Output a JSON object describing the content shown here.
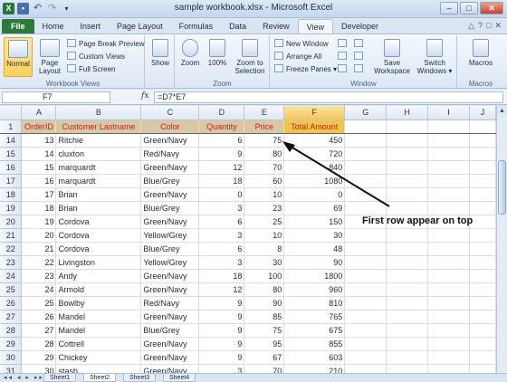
{
  "window": {
    "title": "sample workbook.xlsx - Microsoft Excel",
    "controls": {
      "minimize": "–",
      "restore": "□",
      "close": "✕"
    }
  },
  "qat": {
    "excel": "X",
    "save": "▪",
    "undo": "↶",
    "redo": "↷",
    "more": "▾"
  },
  "ribbon_tabs": [
    "File",
    "Home",
    "Insert",
    "Page Layout",
    "Formulas",
    "Data",
    "Review",
    "View",
    "Developer"
  ],
  "active_tab": "View",
  "ribbon_right": {
    "minimize": "△",
    "help": "?",
    "restore": "□",
    "close": "✕"
  },
  "groups": {
    "workbook_views": {
      "label": "Workbook Views",
      "normal": "Normal",
      "page_layout": "Page Layout",
      "page_break_preview": "Page Break Preview",
      "custom_views": "Custom Views",
      "full_screen": "Full Screen"
    },
    "show": {
      "label": "Show"
    },
    "zoom": {
      "label": "Zoom",
      "zoom": "Zoom",
      "zoom100": "100%",
      "zoom_to_selection": "Zoom to Selection"
    },
    "window": {
      "label": "Window",
      "new_window": "New Window",
      "arrange_all": "Arrange All",
      "freeze_panes": "Freeze Panes ▾",
      "save_workspace": "Save Workspace",
      "switch_windows": "Switch Windows ▾"
    },
    "macros": {
      "label": "Macros",
      "macros": "Macros"
    }
  },
  "formula_bar": {
    "name_box": "F7",
    "fx": "fx",
    "formula": "=D7*E7"
  },
  "columns": [
    "A",
    "B",
    "C",
    "D",
    "E",
    "F",
    "G",
    "H",
    "I",
    "J"
  ],
  "selected_column": "F",
  "header_row": {
    "row": "1",
    "cells": [
      "OrderID",
      "Customer Lastname",
      "Color",
      "Quantity",
      "Price",
      "Total Amount"
    ]
  },
  "rows": [
    {
      "row": "14",
      "id": "13",
      "name": "Ritchie",
      "color": "Green/Navy",
      "qty": "6",
      "price": "75",
      "total": "450"
    },
    {
      "row": "15",
      "id": "14",
      "name": "cluxton",
      "color": "Red/Navy",
      "qty": "9",
      "price": "80",
      "total": "720"
    },
    {
      "row": "16",
      "id": "15",
      "name": "marquardt",
      "color": "Green/Navy",
      "qty": "12",
      "price": "70",
      "total": "840"
    },
    {
      "row": "17",
      "id": "16",
      "name": "marquardt",
      "color": "Blue/Grey",
      "qty": "18",
      "price": "60",
      "total": "1080"
    },
    {
      "row": "18",
      "id": "17",
      "name": "Brian",
      "color": "Green/Navy",
      "qty": "0",
      "price": "10",
      "total": "0"
    },
    {
      "row": "19",
      "id": "18",
      "name": "Brian",
      "color": "Blue/Grey",
      "qty": "3",
      "price": "23",
      "total": "69"
    },
    {
      "row": "20",
      "id": "19",
      "name": "Cordova",
      "color": "Green/Navy",
      "qty": "6",
      "price": "25",
      "total": "150"
    },
    {
      "row": "21",
      "id": "20",
      "name": "Cordova",
      "color": "Yellow/Grey",
      "qty": "3",
      "price": "10",
      "total": "30"
    },
    {
      "row": "22",
      "id": "21",
      "name": "Cordova",
      "color": "Blue/Grey",
      "qty": "6",
      "price": "8",
      "total": "48"
    },
    {
      "row": "23",
      "id": "22",
      "name": "Livingston",
      "color": "Yellow/Grey",
      "qty": "3",
      "price": "30",
      "total": "90"
    },
    {
      "row": "24",
      "id": "23",
      "name": "Andy",
      "color": "Green/Navy",
      "qty": "18",
      "price": "100",
      "total": "1800"
    },
    {
      "row": "25",
      "id": "24",
      "name": "Armold",
      "color": "Green/Navy",
      "qty": "12",
      "price": "80",
      "total": "960"
    },
    {
      "row": "26",
      "id": "25",
      "name": "Bowlby",
      "color": "Red/Navy",
      "qty": "9",
      "price": "90",
      "total": "810"
    },
    {
      "row": "27",
      "id": "26",
      "name": "Mandel",
      "color": "Green/Navy",
      "qty": "9",
      "price": "85",
      "total": "765"
    },
    {
      "row": "28",
      "id": "27",
      "name": "Mandel",
      "color": "Blue/Grey",
      "qty": "9",
      "price": "75",
      "total": "675"
    },
    {
      "row": "29",
      "id": "28",
      "name": "Cottrell",
      "color": "Green/Navy",
      "qty": "9",
      "price": "95",
      "total": "855"
    },
    {
      "row": "30",
      "id": "29",
      "name": "Chickey",
      "color": "Green/Navy",
      "qty": "9",
      "price": "67",
      "total": "603"
    },
    {
      "row": "31",
      "id": "30",
      "name": "stash",
      "color": "Green/Navy",
      "qty": "3",
      "price": "70",
      "total": "210"
    },
    {
      "row": "32",
      "id": "",
      "name": "",
      "color": "",
      "qty": "",
      "price": "",
      "total": ""
    }
  ],
  "sheet_tabs": [
    "Sheet1",
    "Sheet2",
    "Sheet3",
    "Sheet4"
  ],
  "active_sheet": "Sheet2",
  "annotation": "First row appear on top",
  "colors": {
    "file_tab": "#2a7a3c",
    "header_fill": "#d9c8a6",
    "header_text": "#d11b1b",
    "total_header_fill": "#f0c64a"
  }
}
